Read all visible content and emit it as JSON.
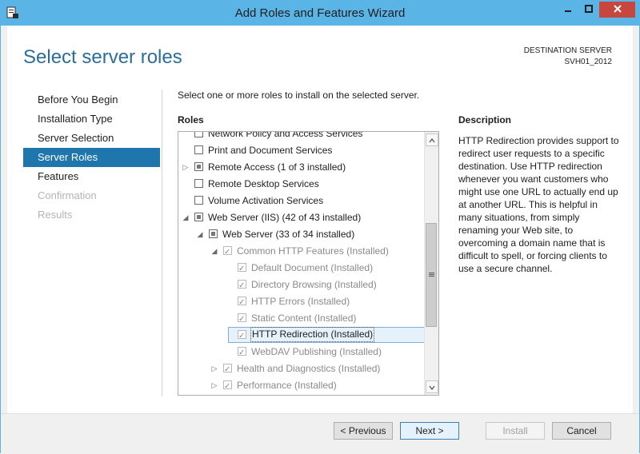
{
  "window": {
    "title": "Add Roles and Features Wizard"
  },
  "header": {
    "heading": "Select server roles",
    "destination_label": "DESTINATION SERVER",
    "destination_server": "SVH01_2012"
  },
  "nav": {
    "items": [
      {
        "label": "Before You Begin",
        "state": "normal"
      },
      {
        "label": "Installation Type",
        "state": "normal"
      },
      {
        "label": "Server Selection",
        "state": "normal"
      },
      {
        "label": "Server Roles",
        "state": "active"
      },
      {
        "label": "Features",
        "state": "normal"
      },
      {
        "label": "Confirmation",
        "state": "disabled"
      },
      {
        "label": "Results",
        "state": "disabled"
      }
    ]
  },
  "main": {
    "instruction": "Select one or more roles to install on the selected server.",
    "roles_label": "Roles",
    "roles": [
      {
        "label": "Network Policy and Access Services",
        "level": 0,
        "expander": "",
        "check": "none",
        "dim": false
      },
      {
        "label": "Print and Document Services",
        "level": 0,
        "expander": "",
        "check": "none",
        "dim": false
      },
      {
        "label": "Remote Access (1 of 3 installed)",
        "level": 0,
        "expander": "collapsed",
        "check": "indeterminate",
        "dim": false
      },
      {
        "label": "Remote Desktop Services",
        "level": 0,
        "expander": "",
        "check": "none",
        "dim": false
      },
      {
        "label": "Volume Activation Services",
        "level": 0,
        "expander": "",
        "check": "none",
        "dim": false
      },
      {
        "label": "Web Server (IIS) (42 of 43 installed)",
        "level": 0,
        "expander": "expanded",
        "check": "indeterminate",
        "dim": false
      },
      {
        "label": "Web Server (33 of 34 installed)",
        "level": 1,
        "expander": "expanded",
        "check": "indeterminate",
        "dim": false
      },
      {
        "label": "Common HTTP Features (Installed)",
        "level": 2,
        "expander": "expanded",
        "check": "checked",
        "dim": true
      },
      {
        "label": "Default Document (Installed)",
        "level": 3,
        "expander": "",
        "check": "checked",
        "dim": true
      },
      {
        "label": "Directory Browsing (Installed)",
        "level": 3,
        "expander": "",
        "check": "checked",
        "dim": true
      },
      {
        "label": "HTTP Errors (Installed)",
        "level": 3,
        "expander": "",
        "check": "checked",
        "dim": true
      },
      {
        "label": "Static Content (Installed)",
        "level": 3,
        "expander": "",
        "check": "checked",
        "dim": true
      },
      {
        "label": "HTTP Redirection (Installed)",
        "level": 3,
        "expander": "",
        "check": "checked",
        "dim": false,
        "selected": true
      },
      {
        "label": "WebDAV Publishing (Installed)",
        "level": 3,
        "expander": "",
        "check": "checked",
        "dim": true
      },
      {
        "label": "Health and Diagnostics (Installed)",
        "level": 2,
        "expander": "collapsed",
        "check": "checked",
        "dim": true
      },
      {
        "label": "Performance (Installed)",
        "level": 2,
        "expander": "collapsed",
        "check": "checked",
        "dim": true
      }
    ]
  },
  "description": {
    "label": "Description",
    "text": "HTTP Redirection provides support to redirect user requests to a specific destination. Use HTTP redirection whenever you want customers who might use one URL to actually end up at another URL. This is helpful in many situations, from simply renaming your Web site, to overcoming a domain name that is difficult to spell, or forcing clients to use a secure channel."
  },
  "footer": {
    "previous": "< Previous",
    "next": "Next >",
    "install": "Install",
    "cancel": "Cancel"
  }
}
